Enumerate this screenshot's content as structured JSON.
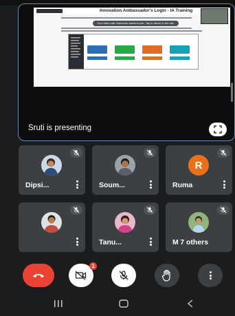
{
  "presentation": {
    "slide_title": "Innovation Ambassador's Login - IA Training",
    "slide_tip": "Your video call. Someone wants to join. Tap to return to the call.",
    "presenter_label": "Sruti is presenting"
  },
  "participants": [
    {
      "name": "Dipsi...",
      "avatar": "photo",
      "mic": "muted"
    },
    {
      "name": "Soum...",
      "avatar": "photo",
      "mic": "muted"
    },
    {
      "name": "Ruma",
      "avatar": "letter",
      "letter": "R",
      "avatar_color": "#e8711a",
      "mic": "muted"
    },
    {
      "name": "",
      "avatar": "photo",
      "mic": "muted"
    },
    {
      "name": "Tanu...",
      "avatar": "photo",
      "mic": "muted"
    },
    {
      "name": "M",
      "others_label": "7 others",
      "avatar": "photo",
      "mic": "muted"
    }
  ],
  "controls": {
    "camera_badge": "1",
    "end_call_color": "#ea4335"
  },
  "icons": [
    "expand-icon",
    "mic-off-icon",
    "more-vert-icon",
    "end-call-icon",
    "camera-off-icon",
    "hand-raise-icon",
    "recents-icon",
    "home-icon",
    "back-icon"
  ]
}
